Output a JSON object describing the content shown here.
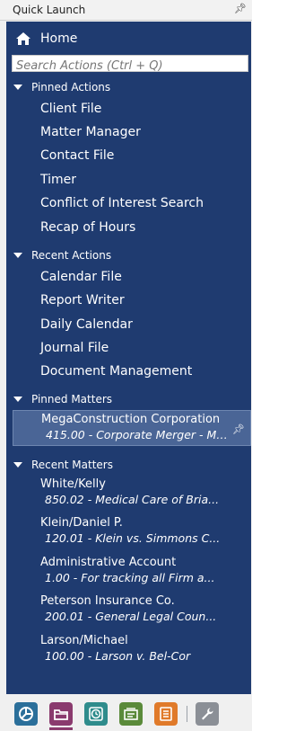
{
  "window": {
    "title": "Quick Launch"
  },
  "home": {
    "label": "Home"
  },
  "search": {
    "placeholder": "Search Actions (Ctrl + Q)"
  },
  "pinned_actions": {
    "header": "Pinned Actions",
    "items": [
      "Client File",
      "Matter Manager",
      "Contact File",
      "Timer",
      "Conflict of Interest Search",
      "Recap of Hours"
    ]
  },
  "recent_actions": {
    "header": "Recent Actions",
    "items": [
      "Calendar File",
      "Report Writer",
      "Daily Calendar",
      "Journal File",
      "Document Management"
    ]
  },
  "pinned_matters": {
    "header": "Pinned Matters",
    "items": [
      {
        "name": "MegaConstruction Corporation",
        "desc": "415.00 - Corporate Merger - Me..."
      }
    ]
  },
  "recent_matters": {
    "header": "Recent Matters",
    "items": [
      {
        "name": "White/Kelly",
        "desc": "850.02 - Medical Care of Bria..."
      },
      {
        "name": "Klein/Daniel P.",
        "desc": "120.01 - Klein vs. Simmons C..."
      },
      {
        "name": "Administrative Account",
        "desc": "1.00 - For tracking all Firm a..."
      },
      {
        "name": "Peterson Insurance Co.",
        "desc": "200.01 - General Legal Coun..."
      },
      {
        "name": "Larson/Michael",
        "desc": "100.00 - Larson v. Bel-Cor"
      }
    ]
  },
  "toolbar": {
    "buttons": [
      {
        "icon": "pie-chart-icon",
        "color": "#2b6f9a"
      },
      {
        "icon": "folder-icon",
        "color": "#8a3a6e",
        "active_underline": "#8a3a6e"
      },
      {
        "icon": "clock-icon",
        "color": "#2f8c8c"
      },
      {
        "icon": "contact-card-icon",
        "color": "#5a8a3a"
      },
      {
        "icon": "document-list-icon",
        "color": "#e07a2a"
      },
      {
        "icon": "wrench-icon",
        "color": "#8b8f96"
      }
    ]
  },
  "colors": {
    "pane_background": "#1f3b70",
    "selected_row": "#4a6596"
  }
}
